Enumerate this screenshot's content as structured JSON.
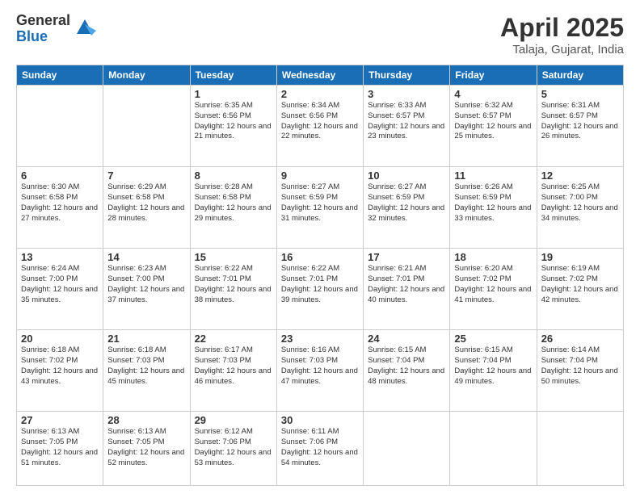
{
  "header": {
    "logo_general": "General",
    "logo_blue": "Blue",
    "month_title": "April 2025",
    "location": "Talaja, Gujarat, India"
  },
  "days_of_week": [
    "Sunday",
    "Monday",
    "Tuesday",
    "Wednesday",
    "Thursday",
    "Friday",
    "Saturday"
  ],
  "weeks": [
    [
      {
        "day": "",
        "info": ""
      },
      {
        "day": "",
        "info": ""
      },
      {
        "day": "1",
        "info": "Sunrise: 6:35 AM\nSunset: 6:56 PM\nDaylight: 12 hours and 21 minutes."
      },
      {
        "day": "2",
        "info": "Sunrise: 6:34 AM\nSunset: 6:56 PM\nDaylight: 12 hours and 22 minutes."
      },
      {
        "day": "3",
        "info": "Sunrise: 6:33 AM\nSunset: 6:57 PM\nDaylight: 12 hours and 23 minutes."
      },
      {
        "day": "4",
        "info": "Sunrise: 6:32 AM\nSunset: 6:57 PM\nDaylight: 12 hours and 25 minutes."
      },
      {
        "day": "5",
        "info": "Sunrise: 6:31 AM\nSunset: 6:57 PM\nDaylight: 12 hours and 26 minutes."
      }
    ],
    [
      {
        "day": "6",
        "info": "Sunrise: 6:30 AM\nSunset: 6:58 PM\nDaylight: 12 hours and 27 minutes."
      },
      {
        "day": "7",
        "info": "Sunrise: 6:29 AM\nSunset: 6:58 PM\nDaylight: 12 hours and 28 minutes."
      },
      {
        "day": "8",
        "info": "Sunrise: 6:28 AM\nSunset: 6:58 PM\nDaylight: 12 hours and 29 minutes."
      },
      {
        "day": "9",
        "info": "Sunrise: 6:27 AM\nSunset: 6:59 PM\nDaylight: 12 hours and 31 minutes."
      },
      {
        "day": "10",
        "info": "Sunrise: 6:27 AM\nSunset: 6:59 PM\nDaylight: 12 hours and 32 minutes."
      },
      {
        "day": "11",
        "info": "Sunrise: 6:26 AM\nSunset: 6:59 PM\nDaylight: 12 hours and 33 minutes."
      },
      {
        "day": "12",
        "info": "Sunrise: 6:25 AM\nSunset: 7:00 PM\nDaylight: 12 hours and 34 minutes."
      }
    ],
    [
      {
        "day": "13",
        "info": "Sunrise: 6:24 AM\nSunset: 7:00 PM\nDaylight: 12 hours and 35 minutes."
      },
      {
        "day": "14",
        "info": "Sunrise: 6:23 AM\nSunset: 7:00 PM\nDaylight: 12 hours and 37 minutes."
      },
      {
        "day": "15",
        "info": "Sunrise: 6:22 AM\nSunset: 7:01 PM\nDaylight: 12 hours and 38 minutes."
      },
      {
        "day": "16",
        "info": "Sunrise: 6:22 AM\nSunset: 7:01 PM\nDaylight: 12 hours and 39 minutes."
      },
      {
        "day": "17",
        "info": "Sunrise: 6:21 AM\nSunset: 7:01 PM\nDaylight: 12 hours and 40 minutes."
      },
      {
        "day": "18",
        "info": "Sunrise: 6:20 AM\nSunset: 7:02 PM\nDaylight: 12 hours and 41 minutes."
      },
      {
        "day": "19",
        "info": "Sunrise: 6:19 AM\nSunset: 7:02 PM\nDaylight: 12 hours and 42 minutes."
      }
    ],
    [
      {
        "day": "20",
        "info": "Sunrise: 6:18 AM\nSunset: 7:02 PM\nDaylight: 12 hours and 43 minutes."
      },
      {
        "day": "21",
        "info": "Sunrise: 6:18 AM\nSunset: 7:03 PM\nDaylight: 12 hours and 45 minutes."
      },
      {
        "day": "22",
        "info": "Sunrise: 6:17 AM\nSunset: 7:03 PM\nDaylight: 12 hours and 46 minutes."
      },
      {
        "day": "23",
        "info": "Sunrise: 6:16 AM\nSunset: 7:03 PM\nDaylight: 12 hours and 47 minutes."
      },
      {
        "day": "24",
        "info": "Sunrise: 6:15 AM\nSunset: 7:04 PM\nDaylight: 12 hours and 48 minutes."
      },
      {
        "day": "25",
        "info": "Sunrise: 6:15 AM\nSunset: 7:04 PM\nDaylight: 12 hours and 49 minutes."
      },
      {
        "day": "26",
        "info": "Sunrise: 6:14 AM\nSunset: 7:04 PM\nDaylight: 12 hours and 50 minutes."
      }
    ],
    [
      {
        "day": "27",
        "info": "Sunrise: 6:13 AM\nSunset: 7:05 PM\nDaylight: 12 hours and 51 minutes."
      },
      {
        "day": "28",
        "info": "Sunrise: 6:13 AM\nSunset: 7:05 PM\nDaylight: 12 hours and 52 minutes."
      },
      {
        "day": "29",
        "info": "Sunrise: 6:12 AM\nSunset: 7:06 PM\nDaylight: 12 hours and 53 minutes."
      },
      {
        "day": "30",
        "info": "Sunrise: 6:11 AM\nSunset: 7:06 PM\nDaylight: 12 hours and 54 minutes."
      },
      {
        "day": "",
        "info": ""
      },
      {
        "day": "",
        "info": ""
      },
      {
        "day": "",
        "info": ""
      }
    ]
  ]
}
